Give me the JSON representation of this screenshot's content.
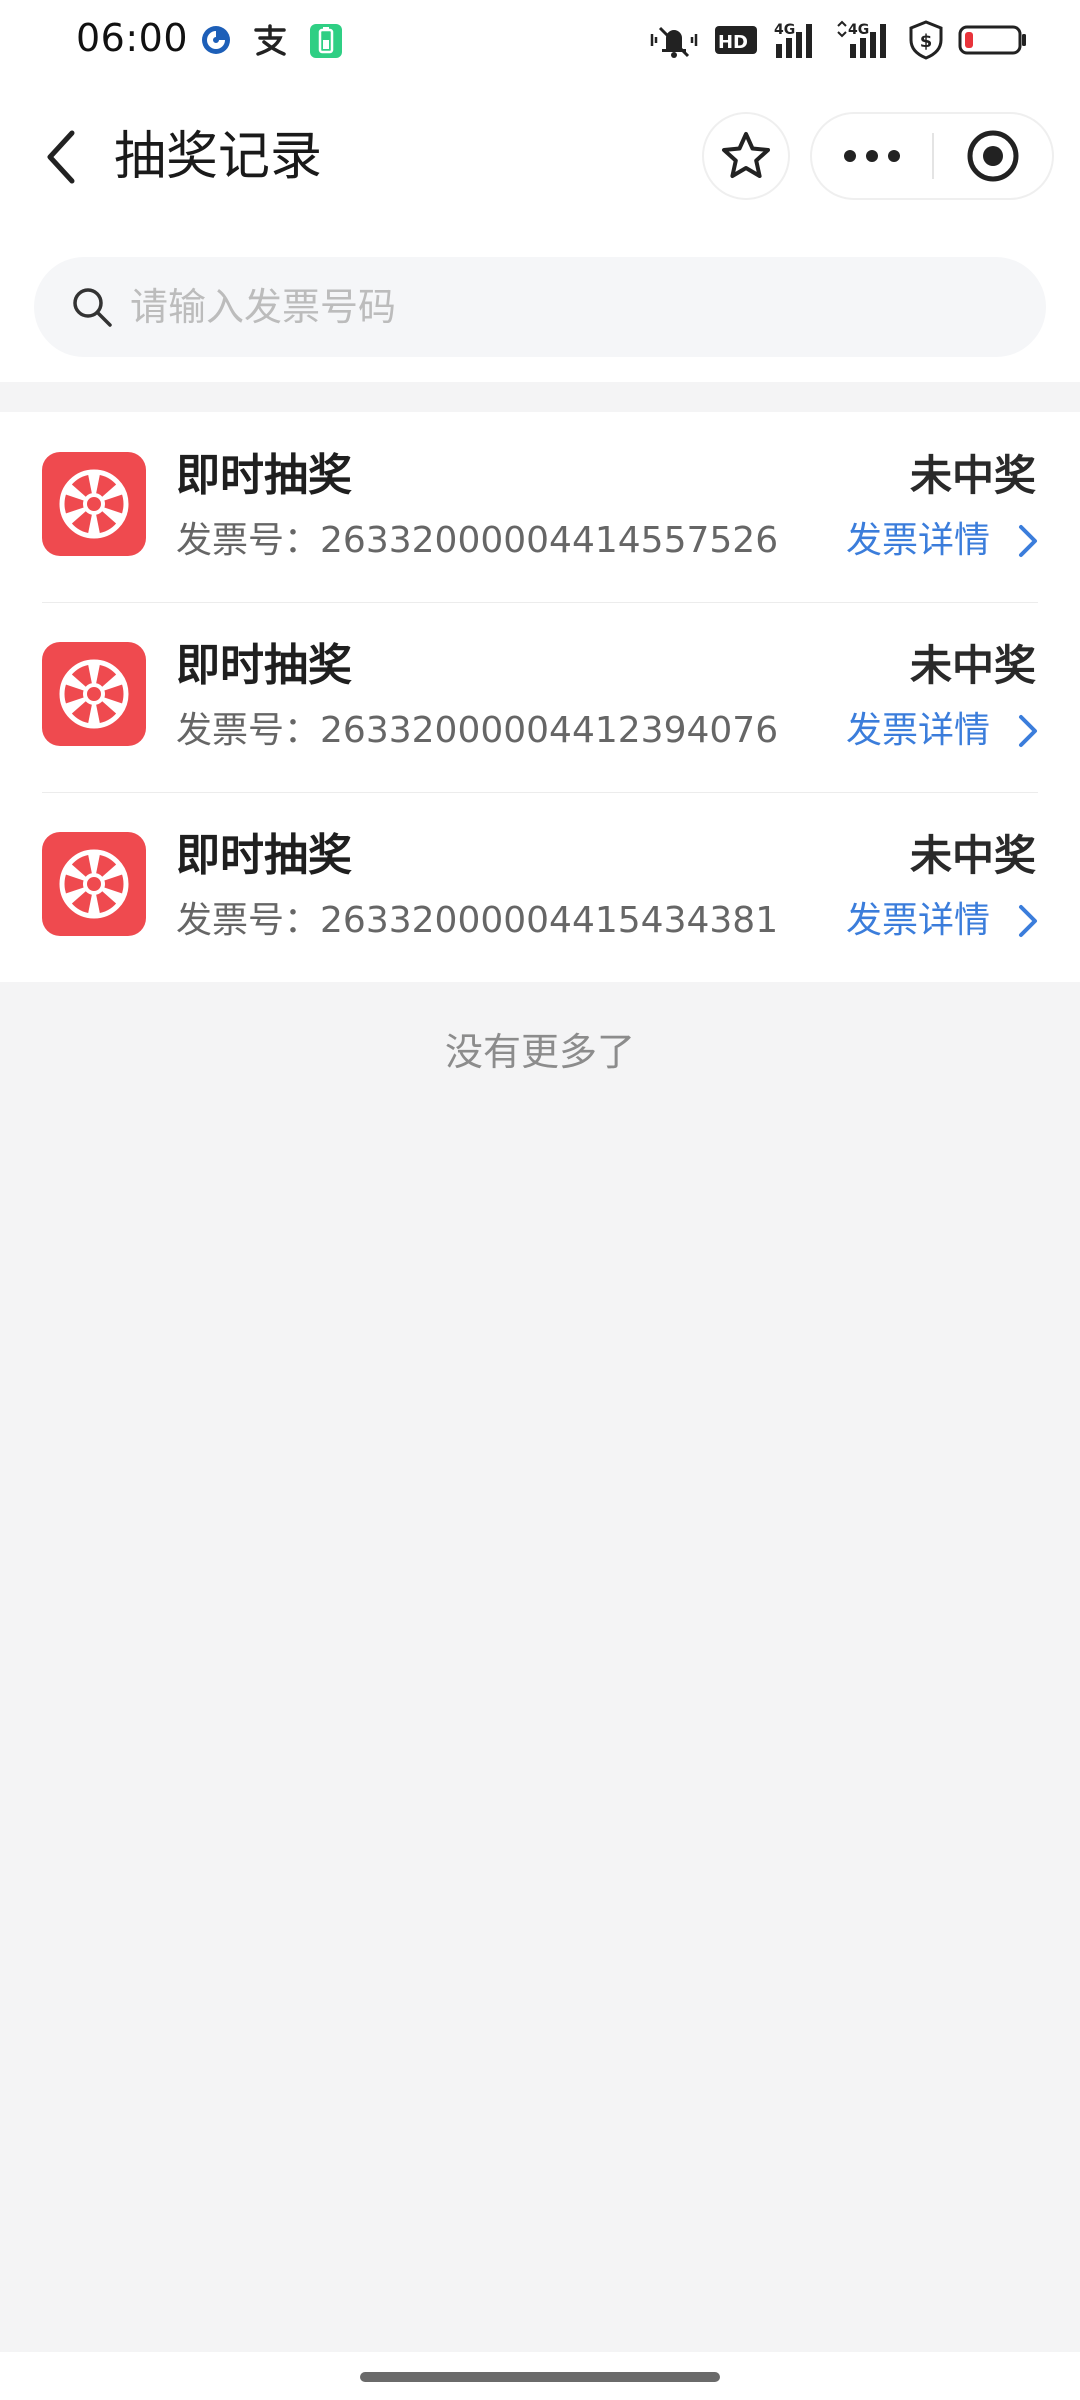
{
  "status_bar": {
    "time": "06:00",
    "left_icons": [
      "bank-icon",
      "alipay-icon",
      "battery-saver-icon"
    ],
    "right_icons": [
      "mute-vibrate-icon",
      "hd-icon",
      "signal-4g-icon",
      "signal-4g-2-icon",
      "security-shield-icon",
      "battery-low-icon"
    ],
    "hd_label": "HD",
    "net_label_1": "4G",
    "net_label_2": "4G"
  },
  "header": {
    "title": "抽奖记录"
  },
  "search": {
    "placeholder": "请输入发票号码",
    "value": ""
  },
  "records": [
    {
      "title": "即时抽奖",
      "invoice_label": "发票号：",
      "invoice_number": "26332000004414557526",
      "status": "未中奖",
      "link_label": "发票详情"
    },
    {
      "title": "即时抽奖",
      "invoice_label": "发票号：",
      "invoice_number": "26332000004412394076",
      "status": "未中奖",
      "link_label": "发票详情"
    },
    {
      "title": "即时抽奖",
      "invoice_label": "发票号：",
      "invoice_number": "26332000004415434381",
      "status": "未中奖",
      "link_label": "发票详情"
    }
  ],
  "footer_text": "没有更多了",
  "colors": {
    "accent_red": "#ef4a4f",
    "link_blue": "#3b7ddb",
    "background": "#f4f4f5"
  }
}
